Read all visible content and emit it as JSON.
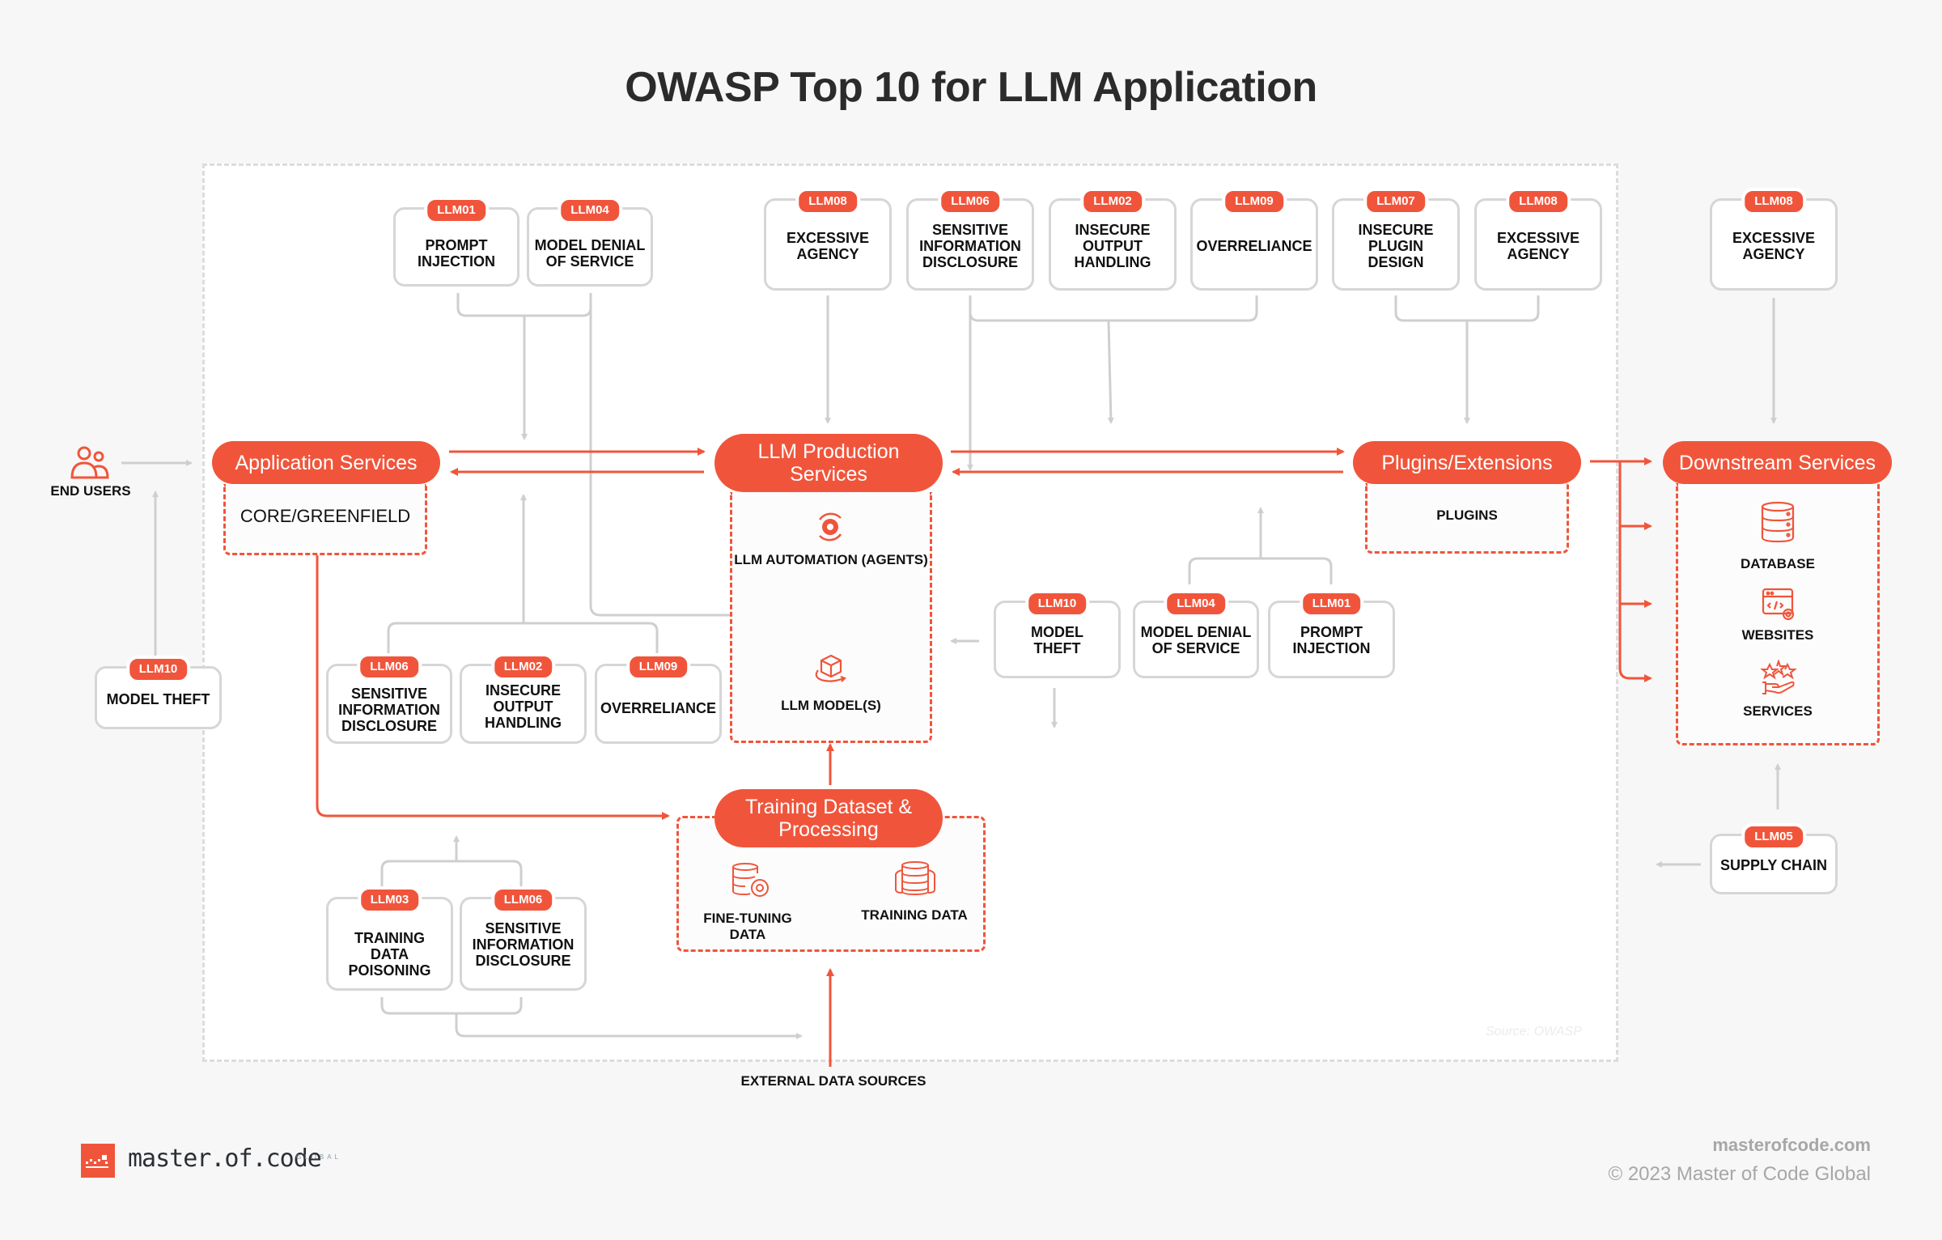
{
  "title": "OWASP Top 10 for LLM Application",
  "source_note": "Source: OWASP",
  "colors": {
    "accent": "#f0553b",
    "connector": "#cfcfcf",
    "box_border": "#d6d6d6",
    "background": "#f7f7f7",
    "text": "#111111"
  },
  "actors": {
    "end_users": {
      "label": "END USERS",
      "icon": "users-icon"
    },
    "external_data_sources": {
      "label": "EXTERNAL DATA SOURCES"
    }
  },
  "components": {
    "application_services": {
      "label": "Application Services",
      "zone_items": [
        "CORE/GREENFIELD"
      ]
    },
    "llm_production_services": {
      "label": "LLM Production Services",
      "zone_items": [
        {
          "label": "LLM AUTOMATION (AGENTS)",
          "icon": "gear-cycle-icon"
        },
        {
          "label": "LLM MODEL(S)",
          "icon": "cube-rotate-icon"
        }
      ]
    },
    "plugins_extensions": {
      "label": "Plugins/Extensions",
      "zone_items": [
        "PLUGINS"
      ]
    },
    "downstream_services": {
      "label": "Downstream Services",
      "zone_items": [
        {
          "label": "DATABASE",
          "icon": "database-icon"
        },
        {
          "label": "WEBSITES",
          "icon": "website-code-icon"
        },
        {
          "label": "SERVICES",
          "icon": "hand-stars-icon"
        }
      ]
    },
    "training_dataset": {
      "label": "Training Dataset & Processing",
      "zone_items": [
        {
          "label": "FINE-TUNING DATA",
          "icon": "database-gear-icon"
        },
        {
          "label": "TRAINING DATA",
          "icon": "stacked-database-icon"
        }
      ]
    }
  },
  "risks": {
    "top_left": [
      {
        "id": "LLM01",
        "label": "PROMPT INJECTION"
      },
      {
        "id": "LLM04",
        "label": "MODEL DENIAL OF SERVICE"
      }
    ],
    "top_center": [
      {
        "id": "LLM08",
        "label": "EXCESSIVE AGENCY"
      },
      {
        "id": "LLM06",
        "label": "SENSITIVE INFORMATION DISCLOSURE"
      },
      {
        "id": "LLM02",
        "label": "INSECURE OUTPUT HANDLING"
      },
      {
        "id": "LLM09",
        "label": "OVERRELIANCE"
      },
      {
        "id": "LLM07",
        "label": "INSECURE PLUGIN DESIGN"
      },
      {
        "id": "LLM08",
        "label": "EXCESSIVE AGENCY"
      }
    ],
    "top_right": [
      {
        "id": "LLM08",
        "label": "EXCESSIVE AGENCY"
      }
    ],
    "left": [
      {
        "id": "LLM10",
        "label": "MODEL THEFT"
      }
    ],
    "middle_left": [
      {
        "id": "LLM06",
        "label": "SENSITIVE INFORMATION DISCLOSURE"
      },
      {
        "id": "LLM02",
        "label": "INSECURE OUTPUT HANDLING"
      },
      {
        "id": "LLM09",
        "label": "OVERRELIANCE"
      }
    ],
    "middle_right": [
      {
        "id": "LLM10",
        "label": "MODEL THEFT"
      },
      {
        "id": "LLM04",
        "label": "MODEL DENIAL OF SERVICE"
      },
      {
        "id": "LLM01",
        "label": "PROMPT INJECTION"
      }
    ],
    "bottom_left": [
      {
        "id": "LLM03",
        "label": "TRAINING DATA POISONING"
      },
      {
        "id": "LLM06",
        "label": "SENSITIVE INFORMATION DISCLOSURE"
      }
    ],
    "bottom_right": [
      {
        "id": "LLM05",
        "label": "SUPPLY CHAIN"
      }
    ]
  },
  "footer": {
    "brand": "master.of.code",
    "brand_suffix": "GLOBAL",
    "url": "masterofcode.com",
    "copyright": "© 2023 Master of Code Global"
  }
}
